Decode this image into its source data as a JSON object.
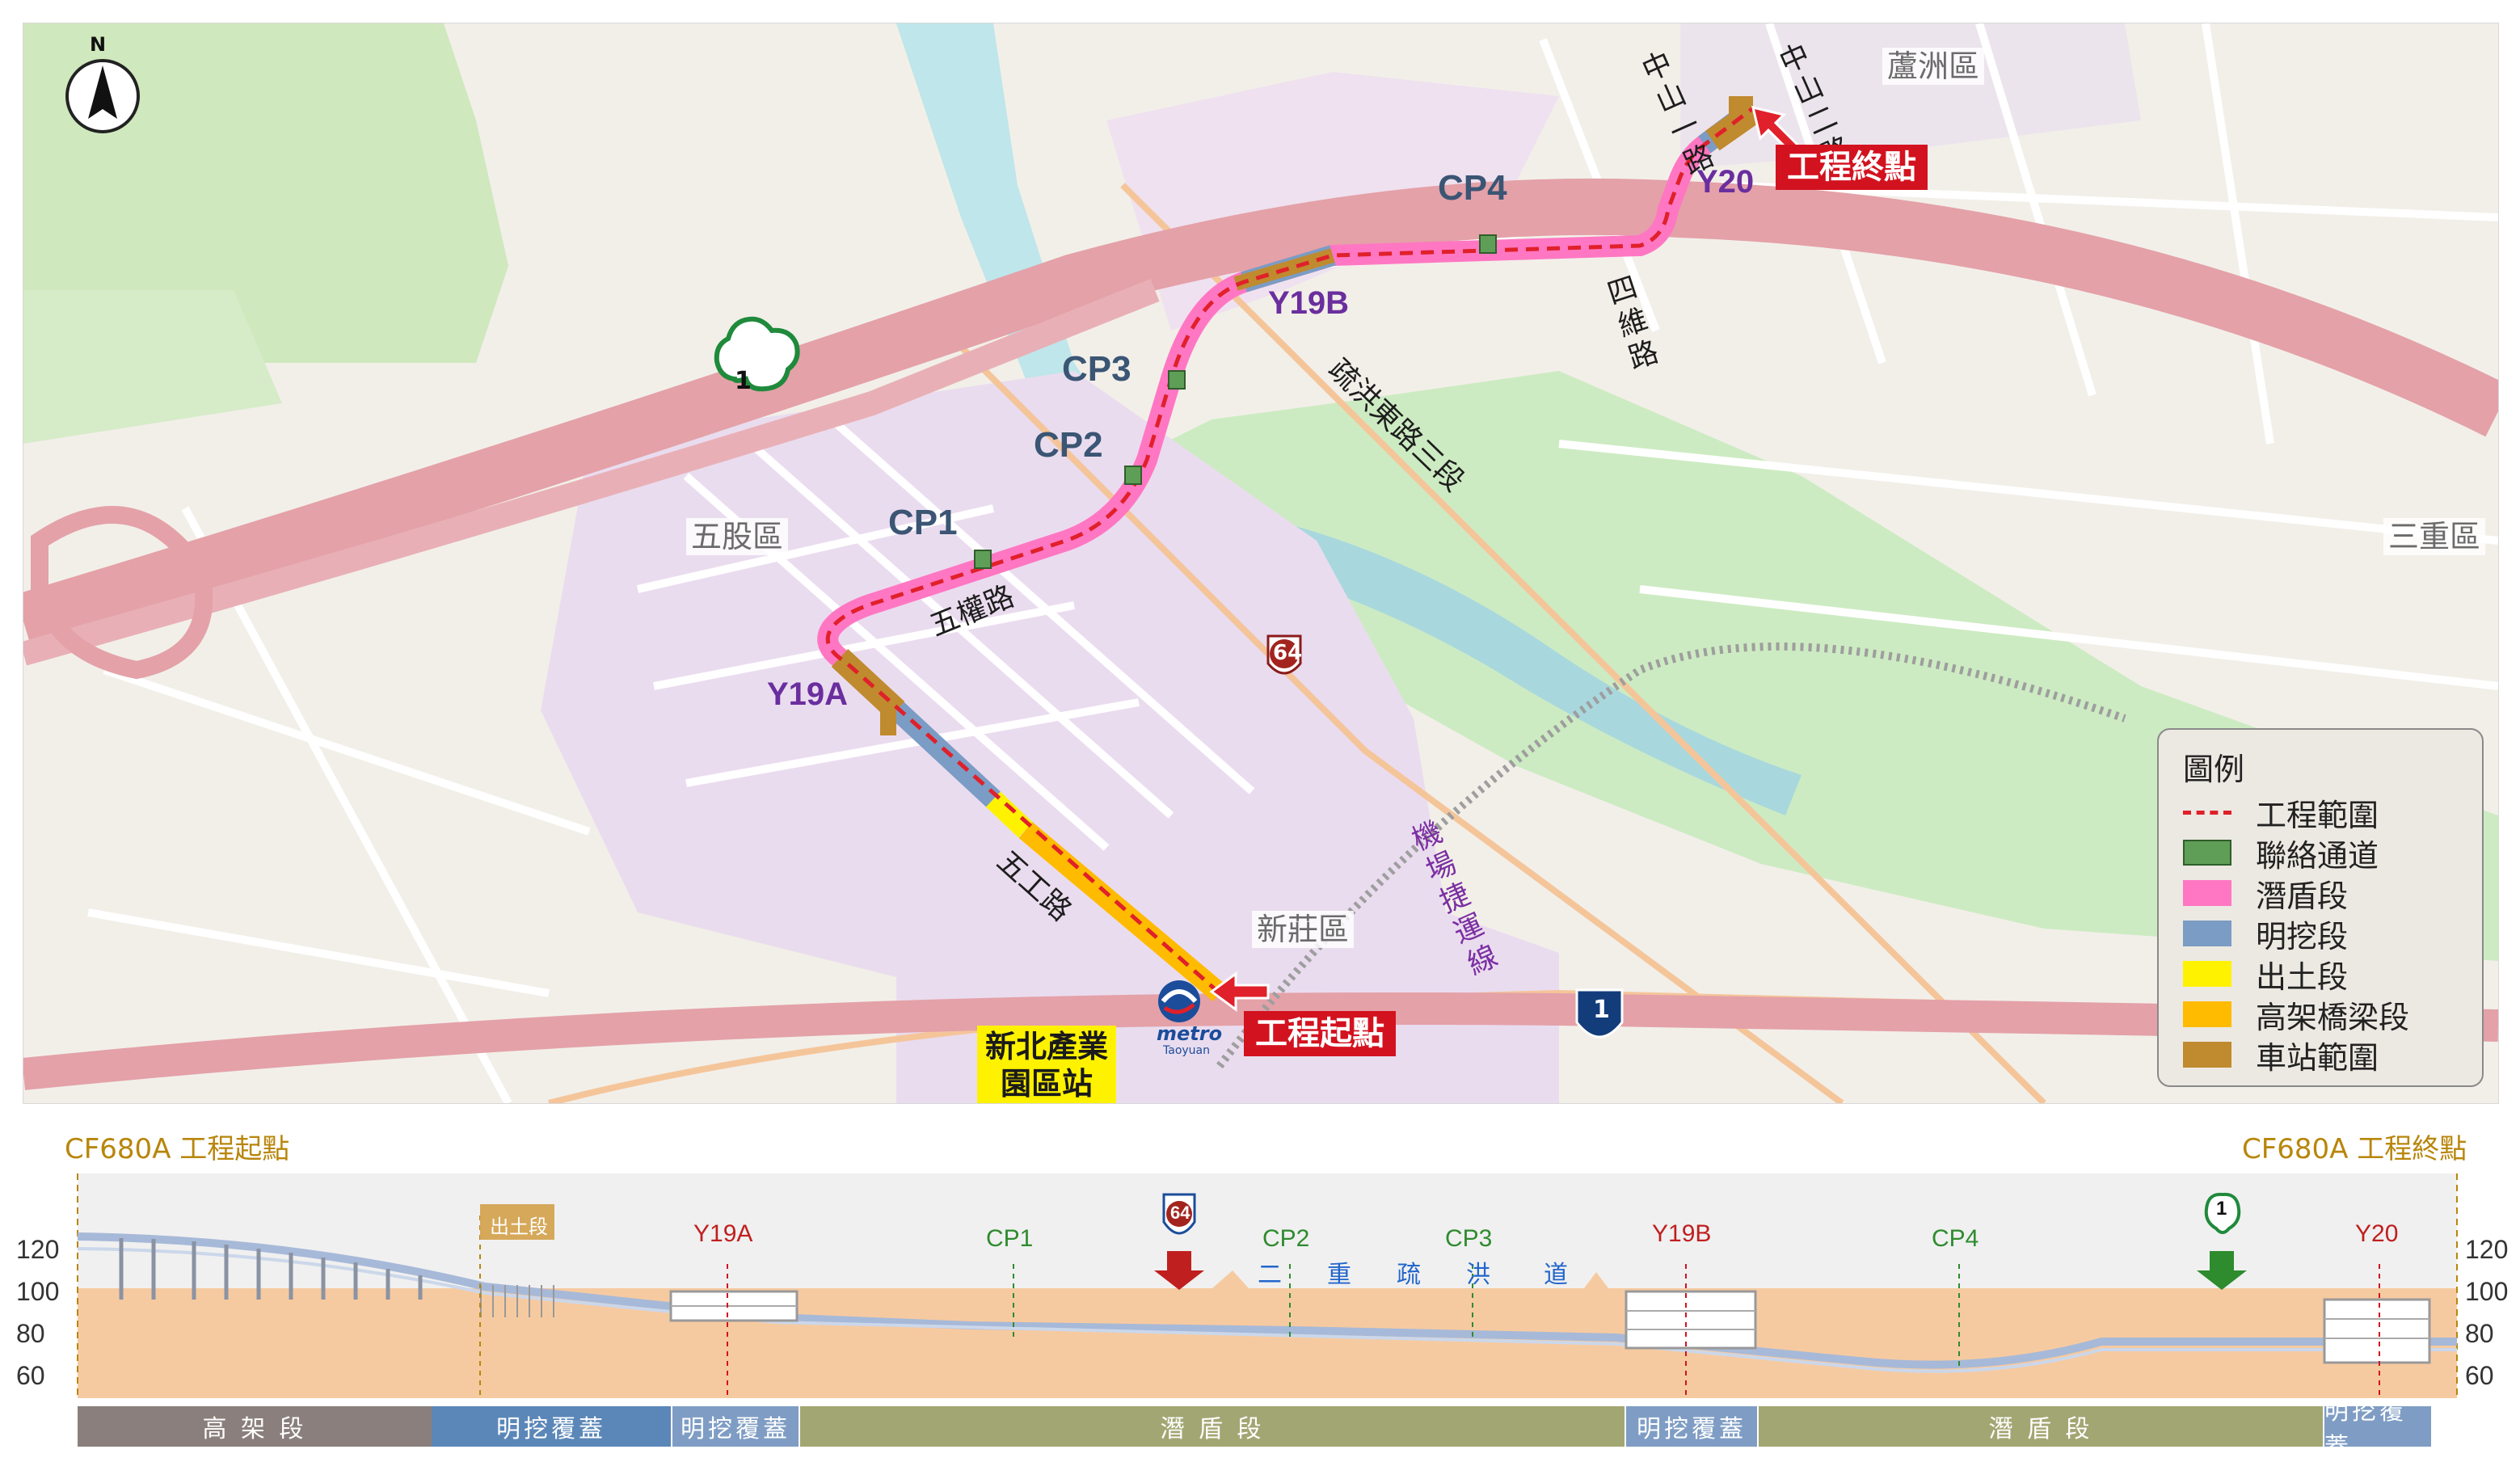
{
  "map": {
    "north": "N",
    "districts": {
      "luzhou": "蘆洲區",
      "wugu": "五股區",
      "xinzhuang": "新莊區",
      "sanchong": "三重區"
    },
    "connectors": {
      "cp1": "CP1",
      "cp2": "CP2",
      "cp3": "CP3",
      "cp4": "CP4"
    },
    "stations": {
      "y19a": "Y19A",
      "y19b": "Y19B",
      "y20": "Y20"
    },
    "roads": {
      "wuquan": "五權路",
      "wugong": "五工路",
      "shuhong_east": "疏洪東路三段",
      "siwei": "四維路",
      "zhongshan_left": "中山一路",
      "zhongshan_right": "中山二路",
      "airport_mrt": "機場捷運線"
    },
    "route_shields": {
      "fwy1_map": "1",
      "prov64": "64",
      "fwy1_south": "1"
    },
    "metro_logo": {
      "word": "metro",
      "sub": "Taoyuan"
    },
    "start_label": "工程起點",
    "end_label": "工程終點",
    "station_name": "新北產業\n園區站"
  },
  "legend": {
    "title": "圖例",
    "items": [
      {
        "label": "工程範圍",
        "color": "#e0202a",
        "style": "dashed"
      },
      {
        "label": "聯絡通道",
        "color": "#5f9e57",
        "style": "box"
      },
      {
        "label": "潛盾段",
        "color": "#ff77c2",
        "style": "fill"
      },
      {
        "label": "明挖段",
        "color": "#7b9cc4",
        "style": "fill"
      },
      {
        "label": "出土段",
        "color": "#fff200",
        "style": "fill"
      },
      {
        "label": "高架橋梁段",
        "color": "#ffbb00",
        "style": "fill"
      },
      {
        "label": "車站範圍",
        "color": "#c08a2e",
        "style": "fill"
      }
    ]
  },
  "profile": {
    "start_caption": "CF680A 工程起點",
    "end_caption": "CF680A 工程終點",
    "y_ticks": [
      "120",
      "100",
      "80",
      "60"
    ],
    "tag_exit": "出土段",
    "points": {
      "y19a": "Y19A",
      "cp1": "CP1",
      "cp2": "CP2",
      "cp3": "CP3",
      "y19b": "Y19B",
      "cp4": "CP4",
      "y20": "Y20"
    },
    "shields": {
      "prov64": "64",
      "fwy1": "1"
    },
    "channel": [
      "二",
      "重",
      "疏",
      "洪",
      "道"
    ],
    "segments": [
      {
        "label": "高 架 段",
        "color": "#8a7f7c"
      },
      {
        "label": "明挖覆蓋",
        "color": "#5b87b8"
      },
      {
        "label": "明挖覆蓋",
        "color": "#7f9dc4"
      },
      {
        "label": "潛 盾 段",
        "color": "#a2a672"
      },
      {
        "label": "明挖覆蓋",
        "color": "#7f9dc4"
      },
      {
        "label": "潛 盾 段",
        "color": "#a2a672"
      },
      {
        "label": "明挖覆蓋",
        "color": "#7f9dc4"
      }
    ]
  }
}
